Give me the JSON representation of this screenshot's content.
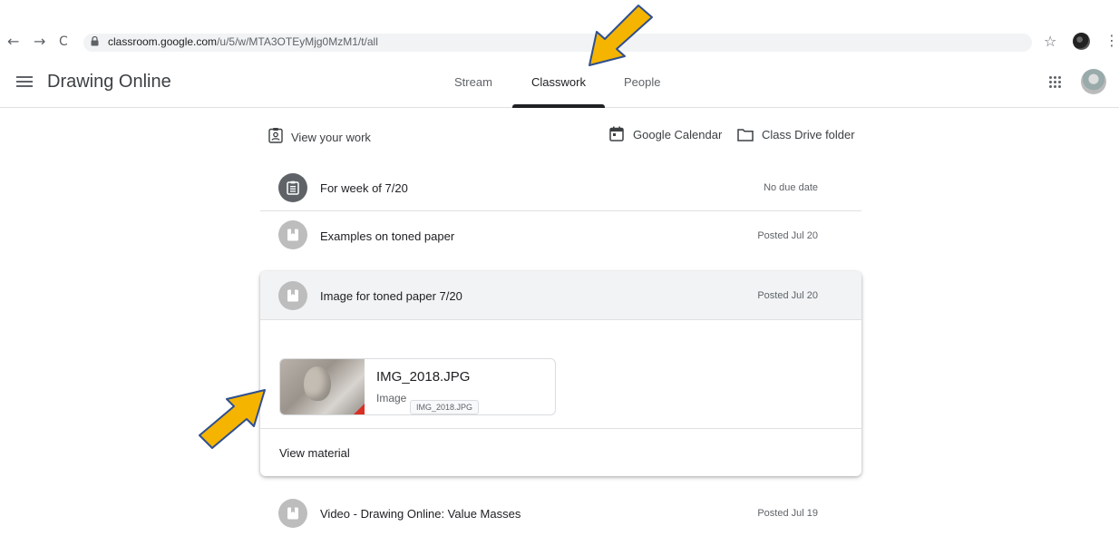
{
  "browser": {
    "url_host": "classroom.google.com",
    "url_path": "/u/5/w/MTA3OTEyMjg0MzM1/t/all",
    "back": "←",
    "forward": "→",
    "reload": "C",
    "star": "☆",
    "menu": "⋮"
  },
  "header": {
    "title": "Drawing Online",
    "tabs": [
      {
        "label": "Stream"
      },
      {
        "label": "Classwork"
      },
      {
        "label": "People"
      }
    ],
    "active_tab": "Classwork"
  },
  "toolbar": {
    "view_work": "View your work",
    "calendar": "Google Calendar",
    "drive": "Class Drive folder"
  },
  "items": [
    {
      "title": "For week of 7/20",
      "date": "No due date",
      "icon": "assignment-icon"
    },
    {
      "title": "Examples on toned paper",
      "date": "Posted Jul 20",
      "icon": "material-icon"
    },
    {
      "title": "Image for toned paper 7/20",
      "date": "Posted Jul 20",
      "icon": "material-icon"
    },
    {
      "title": "Video - Drawing Online: Value Masses",
      "date": "Posted Jul 19",
      "icon": "material-icon"
    }
  ],
  "attachment": {
    "name": "IMG_2018.JPG",
    "type": "Image",
    "tooltip": "IMG_2018.JPG"
  },
  "card": {
    "view_material": "View material"
  },
  "colors": {
    "annotation_arrow": "#f4b400",
    "arrow_outline": "#2f4f8f"
  }
}
